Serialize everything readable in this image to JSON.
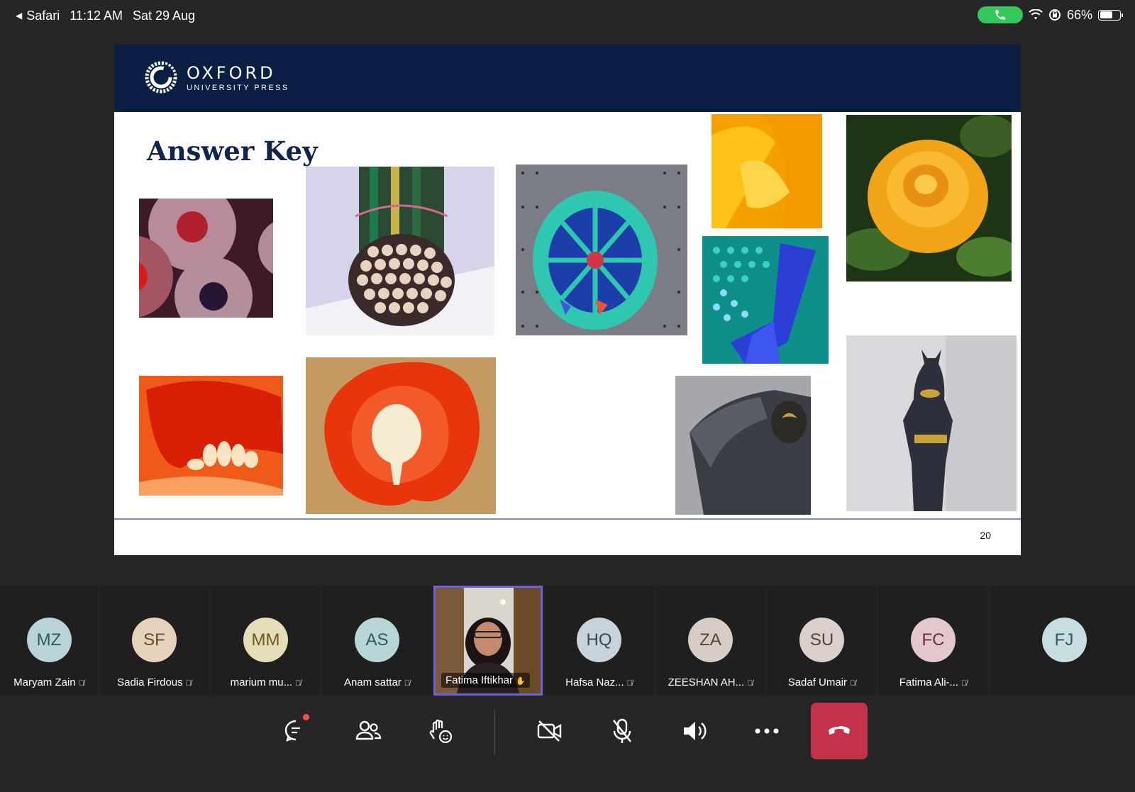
{
  "status_bar": {
    "back_app": "Safari",
    "time": "11:12 AM",
    "date": "Sat 29 Aug",
    "battery": "66%",
    "battery_level": 0.66
  },
  "slide": {
    "brand_name": "OXFORD",
    "brand_sub": "UNIVERSITY PRESS",
    "title": "Answer Key",
    "page_number": "20"
  },
  "participants": [
    {
      "initials": "MZ",
      "name": "Maryam Zain",
      "avatar_bg": "#b8d4d8",
      "avatar_fg": "#2d5a60"
    },
    {
      "initials": "SF",
      "name": "Sadia  Firdous",
      "avatar_bg": "#e6d1bb",
      "avatar_fg": "#6b4a2a"
    },
    {
      "initials": "MM",
      "name": "marium mu...",
      "avatar_bg": "#e6dcb8",
      "avatar_fg": "#6b5a22"
    },
    {
      "initials": "AS",
      "name": "Anam sattar",
      "avatar_bg": "#b8d6d8",
      "avatar_fg": "#2d5a60"
    },
    {
      "initials": "",
      "name": "Fatima Iftikhar"
    },
    {
      "initials": "HQ",
      "name": "Hafsa Naz...",
      "avatar_bg": "#c7d2da",
      "avatar_fg": "#34495a"
    },
    {
      "initials": "ZA",
      "name": "ZEESHAN AH...",
      "avatar_bg": "#d8ccc6",
      "avatar_fg": "#5a4038"
    },
    {
      "initials": "SU",
      "name": "Sadaf  Umair",
      "avatar_bg": "#dbcfcb",
      "avatar_fg": "#5a403a"
    },
    {
      "initials": "FC",
      "name": "Fatima Ali-...",
      "avatar_bg": "#e2c8ca",
      "avatar_fg": "#6b3038"
    },
    {
      "initials": "FJ",
      "name": "",
      "avatar_bg": "#c7dde0",
      "avatar_fg": "#2d5a60"
    }
  ],
  "controls": {
    "chat": "chat-icon",
    "people": "people-icon",
    "react": "raise-hand-icon",
    "camera": "camera-off-icon",
    "mic": "mic-off-icon",
    "speaker": "speaker-icon",
    "more": "more-icon",
    "hangup": "hang-up-icon",
    "hangup_color": "#c4314b"
  }
}
